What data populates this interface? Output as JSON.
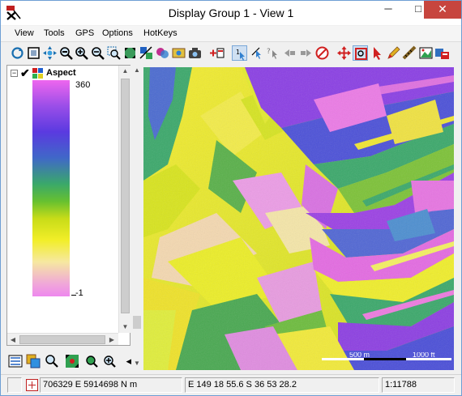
{
  "window": {
    "title": "Display Group 1 - View 1",
    "controls": {
      "minimize": "─",
      "maximize": "□",
      "close": "✕"
    }
  },
  "menu": {
    "items": [
      "View",
      "Tools",
      "GPS",
      "Options",
      "HotKeys"
    ]
  },
  "toolbar": {
    "icons": [
      "redraw-icon",
      "full-view-icon",
      "pan-icon",
      "zoom-to-icon",
      "zoom-in-icon",
      "zoom-out-icon",
      "zoom-box-icon",
      "zoom-full-icon",
      "zoom-layer-icon",
      "blend-icon",
      "snapshot-icon",
      "add-layer-icon",
      "select-mode-icon",
      "pointer-query-icon",
      "back-icon",
      "forward-icon",
      "stop-icon",
      "move-icon",
      "zoom-frame-icon",
      "select-arrow-icon",
      "pencil-icon",
      "measure-icon",
      "image-icon",
      "export-icon"
    ]
  },
  "legend": {
    "layer_name": "Aspect",
    "expand_symbol": "−",
    "check_symbol": "✔",
    "ramp_max": "360",
    "ramp_min": "-1"
  },
  "bottom_tools": {
    "icons": [
      "legend-list-icon",
      "layer-manager-icon",
      "search-icon",
      "zoom-layer-icon",
      "zoom-extent-icon",
      "zoom-in-icon",
      "collapse-arrow-icon"
    ]
  },
  "scalebar": {
    "metric_label": "500 m",
    "imperial_label": "1000 ft"
  },
  "status": {
    "grid_coords": "706329 E   5914698 N m",
    "geo_coords": "E 149 18 55.6  S 36 53 28.2",
    "scale": "1:11788"
  },
  "colors": {
    "title_close": "#c7453e",
    "aspect_magenta": "#ee66ee",
    "aspect_blue": "#5a3ae0",
    "aspect_green": "#3aa86a",
    "aspect_yellow": "#f2ee28"
  }
}
